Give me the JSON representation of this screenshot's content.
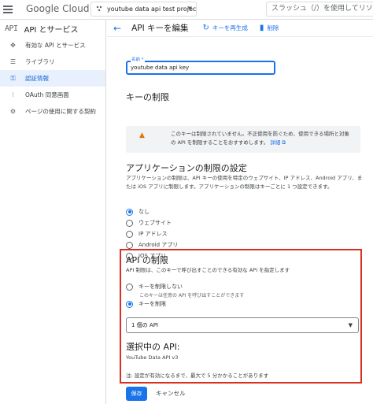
{
  "topbar": {
    "logo_google": "Google",
    "logo_cloud": "Cloud",
    "project": "youtube data api test project",
    "search_placeholder": "スラッシュ（/）を使用してリソース"
  },
  "sidebar": {
    "header_mark": "API",
    "header": "API とサービス",
    "items": [
      {
        "label": "有効な API とサービス",
        "icon": "services-icon"
      },
      {
        "label": "ライブラリ",
        "icon": "library-icon"
      },
      {
        "label": "認証情報",
        "icon": "key-icon",
        "active": true
      },
      {
        "label": "OAuth 同意画面",
        "icon": "oauth-icon"
      },
      {
        "label": "ページの使用に関する契約",
        "icon": "settings-icon"
      }
    ]
  },
  "header": {
    "title": "API キーを編集",
    "regenerate": "キーを再生成",
    "delete": "削除"
  },
  "form": {
    "name_label": "名前 *",
    "name_value": "youtube data api key",
    "key_restrictions_heading": "キーの制限",
    "warning_text": "このキーは制限されていません。不正使用を防ぐため、使用できる場所と対象の API を制限することをおすすめします。",
    "warning_link": "詳細",
    "app_heading": "アプリケーションの制限の設定",
    "app_desc": "アプリケーションの制限は、API キーの使用を特定のウェブサイト、IP アドレス、Android アプリ、または iOS アプリに制限します。アプリケーションの制限はキーごとに 1 つ設定できます。",
    "app_options": [
      {
        "label": "なし",
        "selected": true
      },
      {
        "label": "ウェブサイト",
        "selected": false
      },
      {
        "label": "IP アドレス",
        "selected": false
      },
      {
        "label": "Android アプリ",
        "selected": false
      },
      {
        "label": "iOS アプリ",
        "selected": false
      }
    ],
    "api_heading": "API の制限",
    "api_desc": "API 制限は、このキーで呼び出すことのできる有効な API を指定します",
    "api_options": [
      {
        "label": "キーを制限しない",
        "sub": "このキーは任意の API を呼び出すことができます",
        "selected": false
      },
      {
        "label": "キーを制限",
        "selected": true
      }
    ],
    "api_select_value": "1 個の API",
    "selected_heading": "選択中の API:",
    "selected_api": "YouTube Data API v3",
    "note": "注: 設定が有効になるまで、最大で 5 分かかることがあります",
    "save": "保存",
    "cancel": "キャンセル"
  },
  "colors": {
    "accent": "#1a73e8",
    "highlight_border": "#d93025",
    "warning": "#e37400"
  }
}
